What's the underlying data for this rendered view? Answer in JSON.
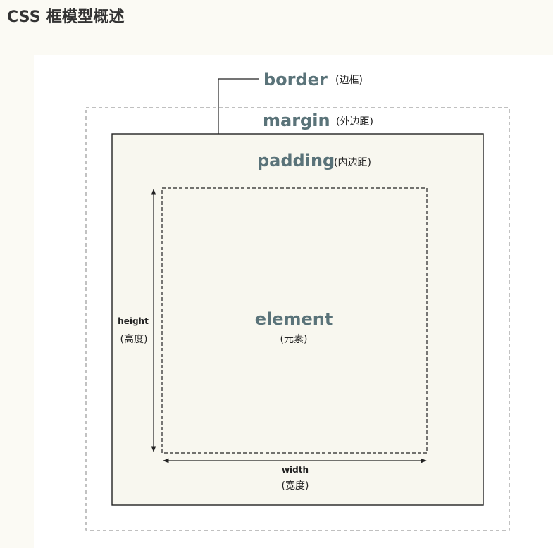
{
  "page": {
    "title": "CSS 框模型概述"
  },
  "diagram": {
    "border": {
      "label": "border",
      "cn": "(边框)"
    },
    "margin": {
      "label": "margin",
      "cn": "(外边距)"
    },
    "padding": {
      "label": "padding",
      "cn": "(内边距)"
    },
    "element": {
      "label": "element",
      "cn": "(元素)"
    },
    "height": {
      "label": "height",
      "cn": "(高度)"
    },
    "width": {
      "label": "width",
      "cn": "(宽度)"
    },
    "colors": {
      "label_teal": "#5a7379",
      "box_fill": "#f8f7ef",
      "line_dark": "#222222",
      "dash_gray": "#9a9a9a"
    }
  }
}
